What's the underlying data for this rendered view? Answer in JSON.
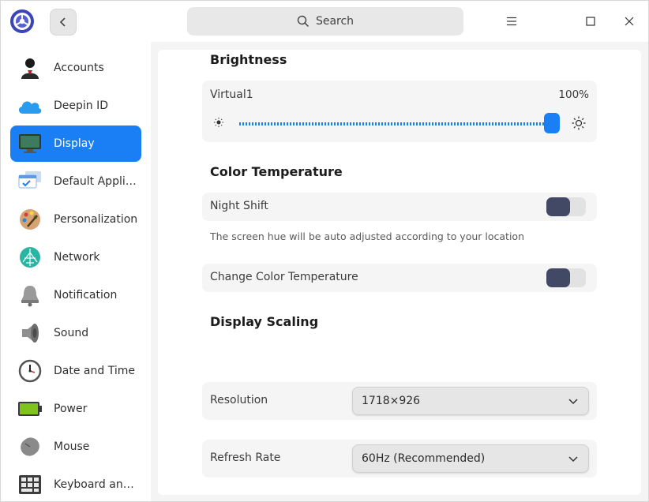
{
  "titlebar": {
    "search_placeholder": "Search"
  },
  "sidebar": {
    "items": [
      {
        "label": "Accounts",
        "icon": "accounts-icon",
        "active": false
      },
      {
        "label": "Deepin ID",
        "icon": "cloud-icon",
        "active": false
      },
      {
        "label": "Display",
        "icon": "display-icon",
        "active": true
      },
      {
        "label": "Default Applic...",
        "icon": "default-apps-icon",
        "active": false
      },
      {
        "label": "Personalization",
        "icon": "palette-icon",
        "active": false
      },
      {
        "label": "Network",
        "icon": "network-icon",
        "active": false
      },
      {
        "label": "Notification",
        "icon": "bell-icon",
        "active": false
      },
      {
        "label": "Sound",
        "icon": "speaker-icon",
        "active": false
      },
      {
        "label": "Date and Time",
        "icon": "clock-icon",
        "active": false
      },
      {
        "label": "Power",
        "icon": "battery-icon",
        "active": false
      },
      {
        "label": "Mouse",
        "icon": "mouse-icon",
        "active": false
      },
      {
        "label": "Keyboard and ...",
        "icon": "keyboard-icon",
        "active": false
      }
    ]
  },
  "brightness": {
    "title": "Brightness",
    "monitor": "Virtual1",
    "value_label": "100%",
    "value": 1.0
  },
  "color_temperature": {
    "title": "Color Temperature",
    "night_shift_label": "Night Shift",
    "night_shift_on": false,
    "night_shift_hint": "The screen hue will be auto adjusted according to your location",
    "change_label": "Change Color Temperature",
    "change_on": false
  },
  "scaling": {
    "title": "Display Scaling"
  },
  "resolution": {
    "label": "Resolution",
    "value": "1718×926"
  },
  "refresh_rate": {
    "label": "Refresh Rate",
    "value": "60Hz (Recommended)"
  },
  "colors": {
    "accent": "#1a7ff5",
    "toggle_knob": "#414964"
  }
}
